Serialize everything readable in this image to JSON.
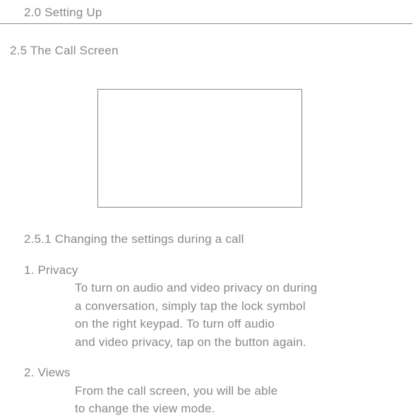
{
  "header": {
    "title": "2.0 Setting Up"
  },
  "section": {
    "title": "2.5 The Call Screen"
  },
  "subsection": {
    "heading": "2.5.1 Changing the settings during a call",
    "items": [
      {
        "title": "1. Privacy",
        "lines": [
          "To turn on audio and video privacy on during",
          "a conversation, simply tap the lock symbol",
          "on the right keypad. To turn off audio",
          "and video privacy, tap on the button again."
        ]
      },
      {
        "title": "2. Views",
        "lines": [
          "From the call screen, you will be able",
          "to change the view mode."
        ]
      }
    ]
  }
}
